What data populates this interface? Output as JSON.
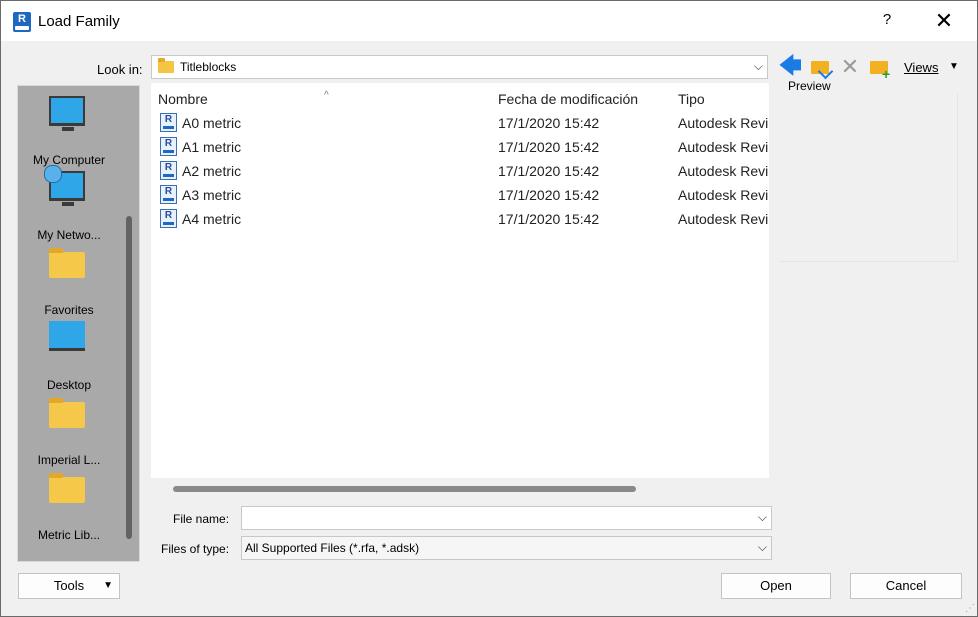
{
  "window": {
    "title": "Load Family",
    "app_icon_letter": "R",
    "help_label": "?",
    "close_label": "✕"
  },
  "toolbar": {
    "look_in_label": "Look in:",
    "look_in_value": "Titleblocks",
    "views_label": "Views",
    "preview_label": "Preview",
    "dropdown_glyph": "⌵",
    "views_arrow_glyph": "▼"
  },
  "places": [
    {
      "label": "My Computer",
      "icon": "computer-icon"
    },
    {
      "label": "My Netwo...",
      "icon": "network-icon"
    },
    {
      "label": "Favorites",
      "icon": "folder-icon"
    },
    {
      "label": "Desktop",
      "icon": "desktop-icon"
    },
    {
      "label": "Imperial L...",
      "icon": "folder-icon"
    },
    {
      "label": "Metric Lib...",
      "icon": "folder-icon"
    }
  ],
  "file_list": {
    "columns": [
      "Nombre",
      "Fecha de modificación",
      "Tipo"
    ],
    "sort_glyph": "^",
    "rows": [
      {
        "name": "A0 metric",
        "date": "17/1/2020 15:42",
        "type": "Autodesk Revi"
      },
      {
        "name": "A1 metric",
        "date": "17/1/2020 15:42",
        "type": "Autodesk Revi"
      },
      {
        "name": "A2 metric",
        "date": "17/1/2020 15:42",
        "type": "Autodesk Revi"
      },
      {
        "name": "A3 metric",
        "date": "17/1/2020 15:42",
        "type": "Autodesk Revi"
      },
      {
        "name": "A4 metric",
        "date": "17/1/2020 15:42",
        "type": "Autodesk Revi"
      }
    ]
  },
  "footer": {
    "file_name_label": "File name:",
    "file_name_value": "",
    "files_of_type_label": "Files of type:",
    "files_of_type_value": "All Supported Files  (*.rfa, *.adsk)",
    "tools_label": "Tools",
    "open_label": "Open",
    "cancel_label": "Cancel"
  },
  "colors": {
    "accent": "#1b7be5",
    "folder": "#f3b122",
    "places_bg": "#a9a9a9"
  }
}
